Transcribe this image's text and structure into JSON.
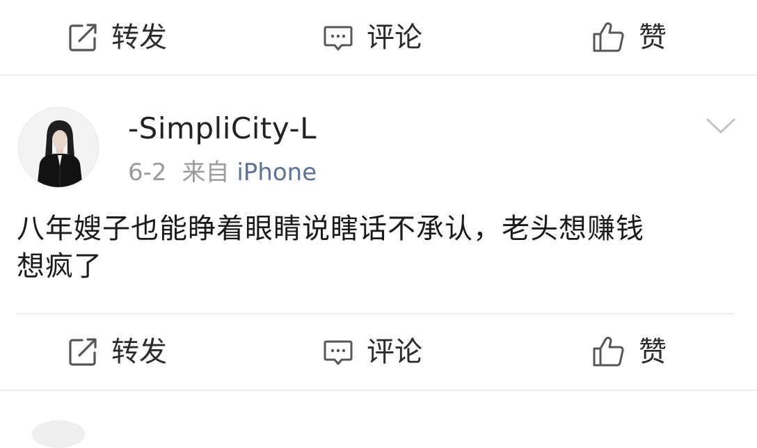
{
  "top_actions": {
    "repost_label": "转发",
    "comment_label": "评论",
    "like_label": "赞"
  },
  "post": {
    "username": "-SimpliCity-L",
    "date": "6-2",
    "source_prefix": "来自",
    "source_device": "iPhone",
    "content_line1": "八年嫂子也能睁着眼睛说瞎话不承认，老头想赚钱",
    "content_line2": "想疯了",
    "actions": {
      "repost_label": "转发",
      "comment_label": "评论",
      "like_label": "赞"
    }
  },
  "colors": {
    "text": "#1a1a1a",
    "meta_gray": "#9a9a9a",
    "device_link": "#5b7398",
    "icon": "#555555",
    "divider": "#ededed"
  },
  "icons": [
    "repost-icon",
    "comment-icon",
    "like-icon",
    "chevron-down-icon",
    "avatar"
  ]
}
